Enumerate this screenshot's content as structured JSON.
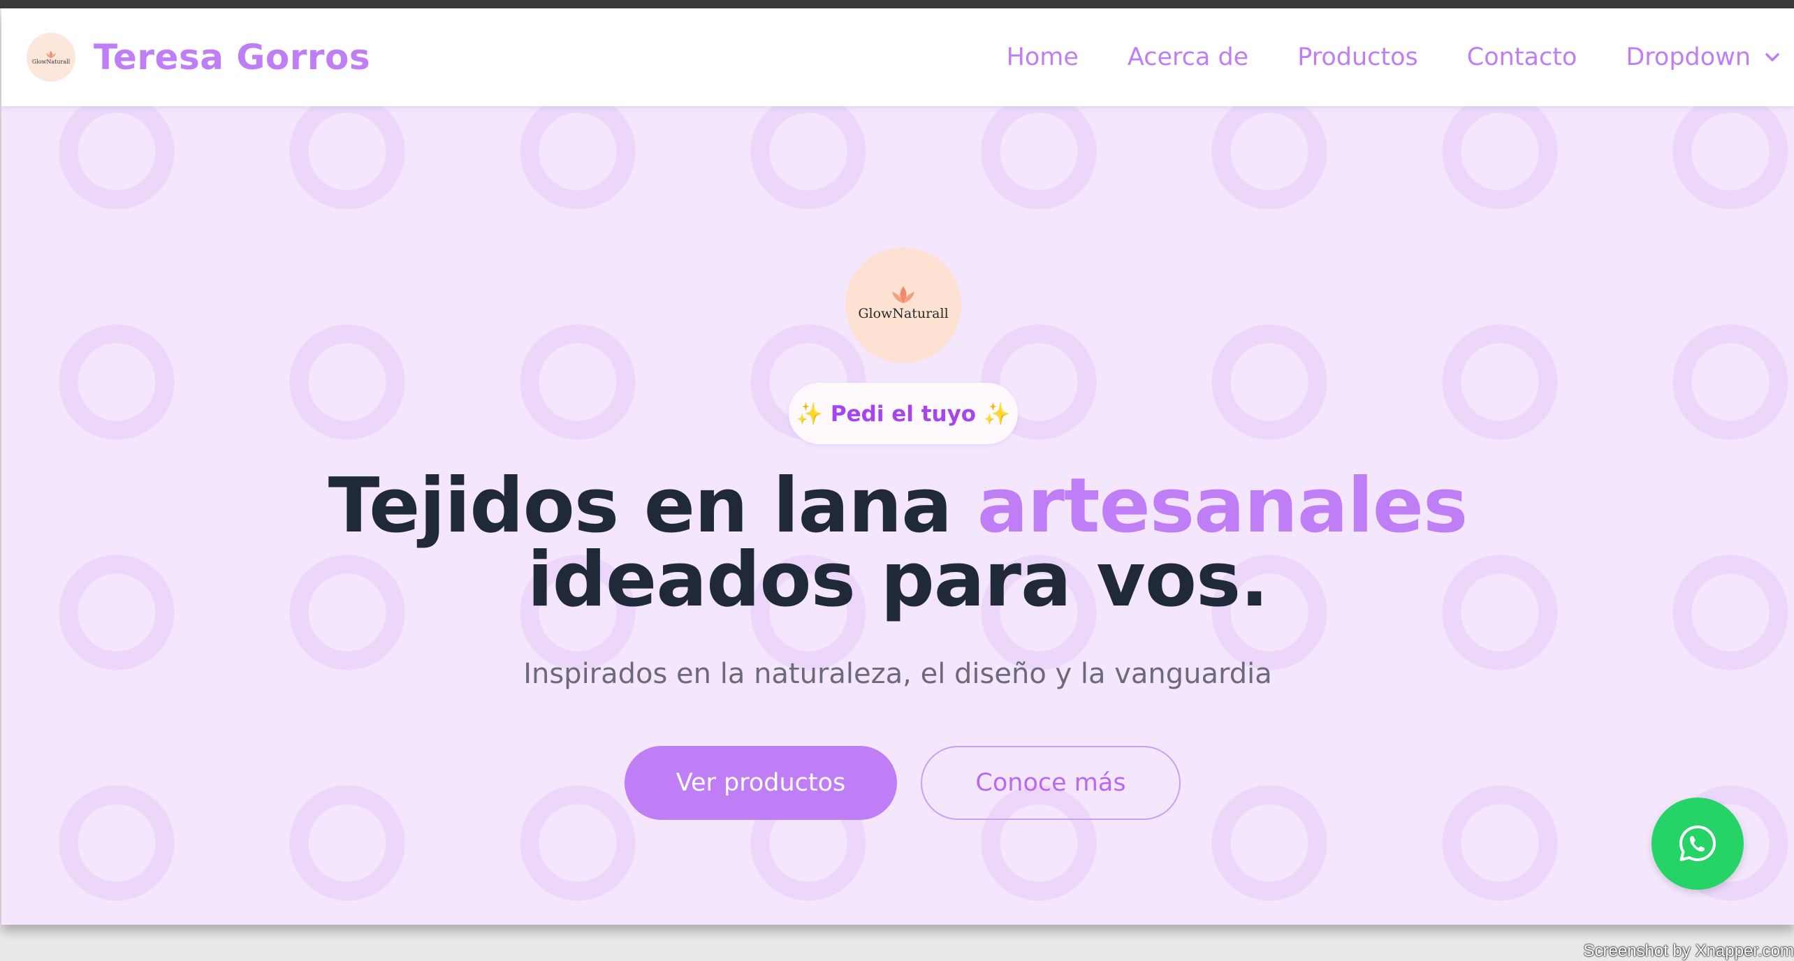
{
  "header": {
    "brand_name": "Teresa Gorros",
    "logo_text": "GlowNaturall",
    "nav": [
      {
        "label": "Home"
      },
      {
        "label": "Acerca de"
      },
      {
        "label": "Productos"
      },
      {
        "label": "Contacto"
      },
      {
        "label": "Dropdown"
      }
    ]
  },
  "hero": {
    "logo_text": "GlowNaturall",
    "badge": "✨ Pedi el tuyo ✨",
    "headline_part1": "Tejidos en lana ",
    "headline_accent": "artesanales",
    "headline_part2": "ideados para vos.",
    "subtitle": "Inspirados en la naturaleza, el diseño y la vanguardia",
    "primary_button": "Ver productos",
    "secondary_button": "Conoce más"
  },
  "icons": {
    "whatsapp": "whatsapp-icon",
    "dropdown": "chevron-down-icon",
    "lotus": "lotus-icon"
  },
  "colors": {
    "accent": "#c07ef6",
    "hero_bg": "#f3e6fd",
    "headline": "#1f2937",
    "whatsapp": "#25d366"
  },
  "watermark": "Screenshot by Xnapper.com"
}
